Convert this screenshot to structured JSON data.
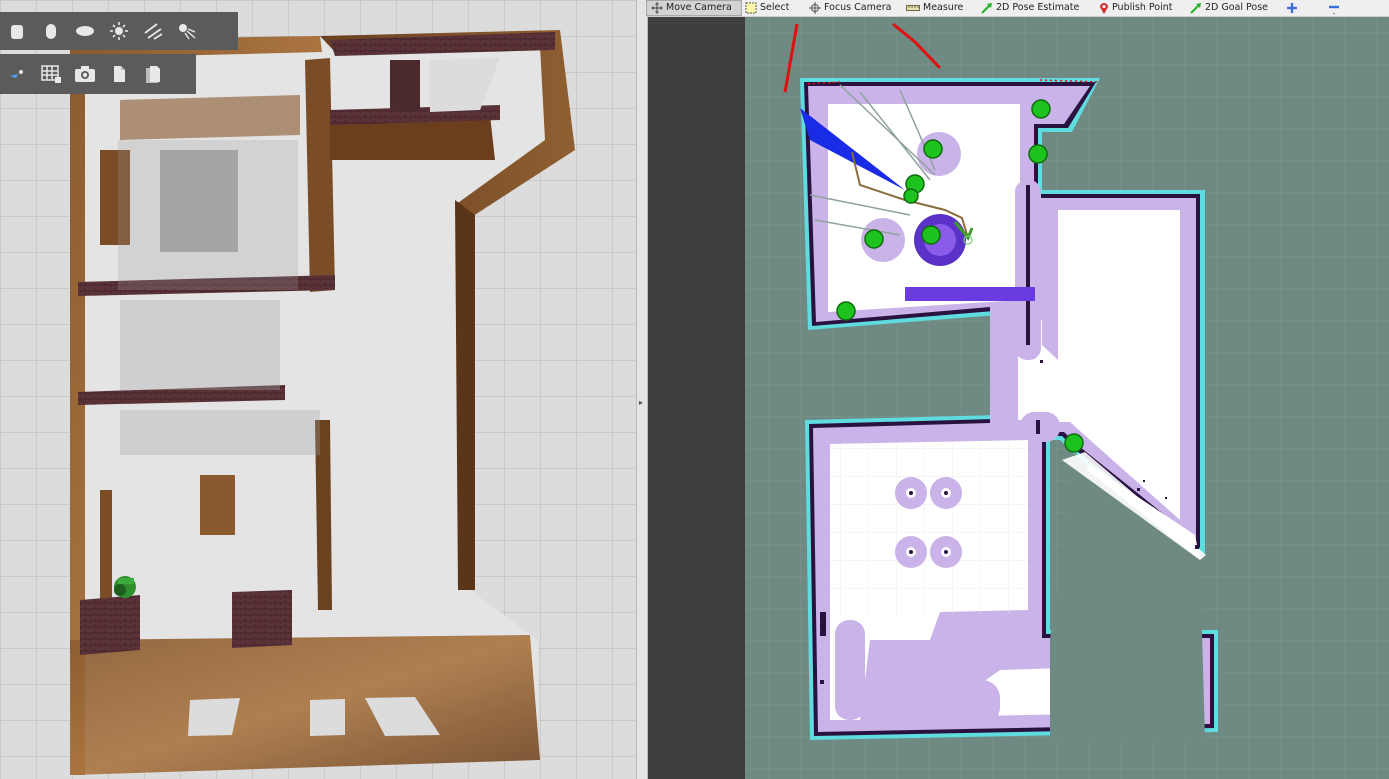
{
  "gazebo": {
    "toolbar_row1": [
      {
        "icon": "box-shape-icon"
      },
      {
        "icon": "cylinder-shape-icon"
      },
      {
        "icon": "sphere-shape-icon"
      },
      {
        "icon": "point-light-icon"
      },
      {
        "icon": "directional-light-icon"
      },
      {
        "icon": "spot-light-icon"
      }
    ],
    "toolbar_row2": [
      {
        "icon": "link-joint-icon"
      },
      {
        "icon": "grid-snap-icon"
      },
      {
        "icon": "camera-screenshot-icon"
      },
      {
        "icon": "copy-icon"
      },
      {
        "icon": "paste-icon"
      }
    ]
  },
  "rviz": {
    "tools": [
      {
        "label": "Move Camera",
        "icon": "move-camera-icon",
        "active": true
      },
      {
        "label": "Select",
        "icon": "select-icon",
        "active": false
      },
      {
        "label": "Focus Camera",
        "icon": "focus-camera-icon",
        "active": false
      },
      {
        "label": "Measure",
        "icon": "ruler-icon",
        "active": false
      },
      {
        "label": "2D Pose Estimate",
        "icon": "green-arrow-icon",
        "active": false
      },
      {
        "label": "Publish Point",
        "icon": "map-pin-icon",
        "active": false
      },
      {
        "label": "2D Goal Pose",
        "icon": "green-arrow-icon",
        "active": false
      },
      {
        "label": "",
        "icon": "plus-icon",
        "active": false
      },
      {
        "label": "",
        "icon": "minus-icon",
        "active": false
      }
    ],
    "colors": {
      "background": "#6f8a82",
      "free_space": "#ffffff",
      "inflation": "#c9b3e8",
      "wall": "#2a1240",
      "edge": "#5fdce0",
      "waypoint": "#1ec21e",
      "laser": "#1a2be6",
      "path": "#8a6b3c",
      "frontier": "#e01010"
    }
  }
}
